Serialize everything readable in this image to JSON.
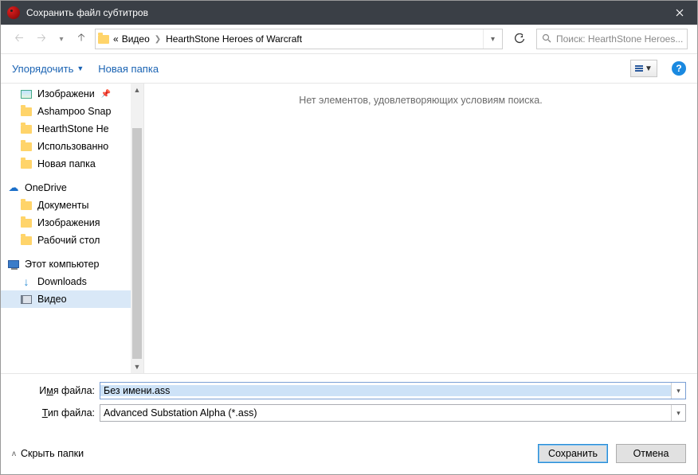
{
  "window": {
    "title": "Сохранить файл субтитров"
  },
  "address": {
    "prefix": "«",
    "seg1": "Видео",
    "seg2": "HearthStone  Heroes of Warcraft"
  },
  "search": {
    "placeholder": "Поиск: HearthStone  Heroes..."
  },
  "toolbar": {
    "organize": "Упорядочить",
    "new_folder": "Новая папка"
  },
  "tree": {
    "images": "Изображени",
    "ashampoo": "Ashampoo Snap",
    "hearthstone": "HearthStone  He",
    "used": "Использованно",
    "new_folder": "Новая папка",
    "onedrive": "OneDrive",
    "documents": "Документы",
    "images2": "Изображения",
    "desktop": "Рабочий стол",
    "this_pc": "Этот компьютер",
    "downloads": "Downloads",
    "video": "Видео"
  },
  "content": {
    "empty": "Нет элементов, удовлетворяющих условиям поиска."
  },
  "fields": {
    "filename_label_pre": "И",
    "filename_label_u": "м",
    "filename_label_post": "я файла:",
    "filename_value": "Без имени.ass",
    "filetype_label_pre": "",
    "filetype_label_u": "Т",
    "filetype_label_post": "ип файла:",
    "filetype_value": "Advanced Substation Alpha (*.ass)"
  },
  "footer": {
    "hide_folders": "Скрыть папки",
    "save": "Сохранить",
    "cancel": "Отмена"
  }
}
